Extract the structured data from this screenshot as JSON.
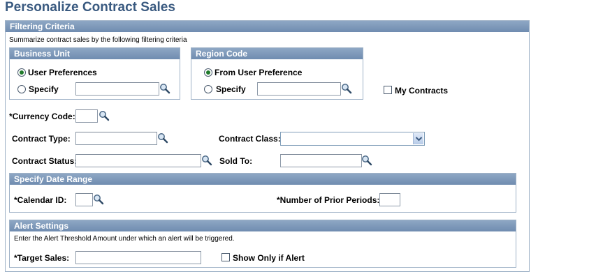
{
  "page": {
    "title": "Personalize Contract Sales"
  },
  "filtering": {
    "header": "Filtering Criteria",
    "description": "Summarize contract sales by the following filtering criteria",
    "business_unit": {
      "header": "Business Unit",
      "option_user_pref": "User Preferences",
      "option_specify": "Specify",
      "selected": "User Preferences",
      "specify_value": ""
    },
    "region_code": {
      "header": "Region Code",
      "option_user_pref": "From User Preference",
      "option_specify": "Specify",
      "selected": "From User Preference",
      "specify_value": ""
    },
    "my_contracts": {
      "label": "My Contracts",
      "checked": false
    },
    "currency_code": {
      "label": "*Currency Code:",
      "value": ""
    },
    "contract_type": {
      "label": "Contract Type:",
      "value": ""
    },
    "contract_class": {
      "label": "Contract Class:",
      "value": ""
    },
    "contract_status": {
      "label": "Contract Status:",
      "value": ""
    },
    "sold_to": {
      "label": "Sold To:",
      "value": ""
    }
  },
  "date_range": {
    "header": "Specify Date Range",
    "calendar_id": {
      "label": "*Calendar ID:",
      "value": ""
    },
    "prior_periods": {
      "label": "*Number of Prior Periods:",
      "value": ""
    }
  },
  "alert": {
    "header": "Alert Settings",
    "description": "Enter the Alert Threshold Amount under which an alert will be triggered.",
    "target_sales": {
      "label": "*Target Sales:",
      "value": ""
    },
    "show_only_if_alert": {
      "label": "Show Only if Alert",
      "checked": false
    }
  },
  "icons": {
    "lookup": "magnifier-icon",
    "dropdown": "chevron-down-icon"
  },
  "colors": {
    "title": "#3a5a80",
    "header_bg": "#7f9aba",
    "border": "#9fb2c7"
  }
}
